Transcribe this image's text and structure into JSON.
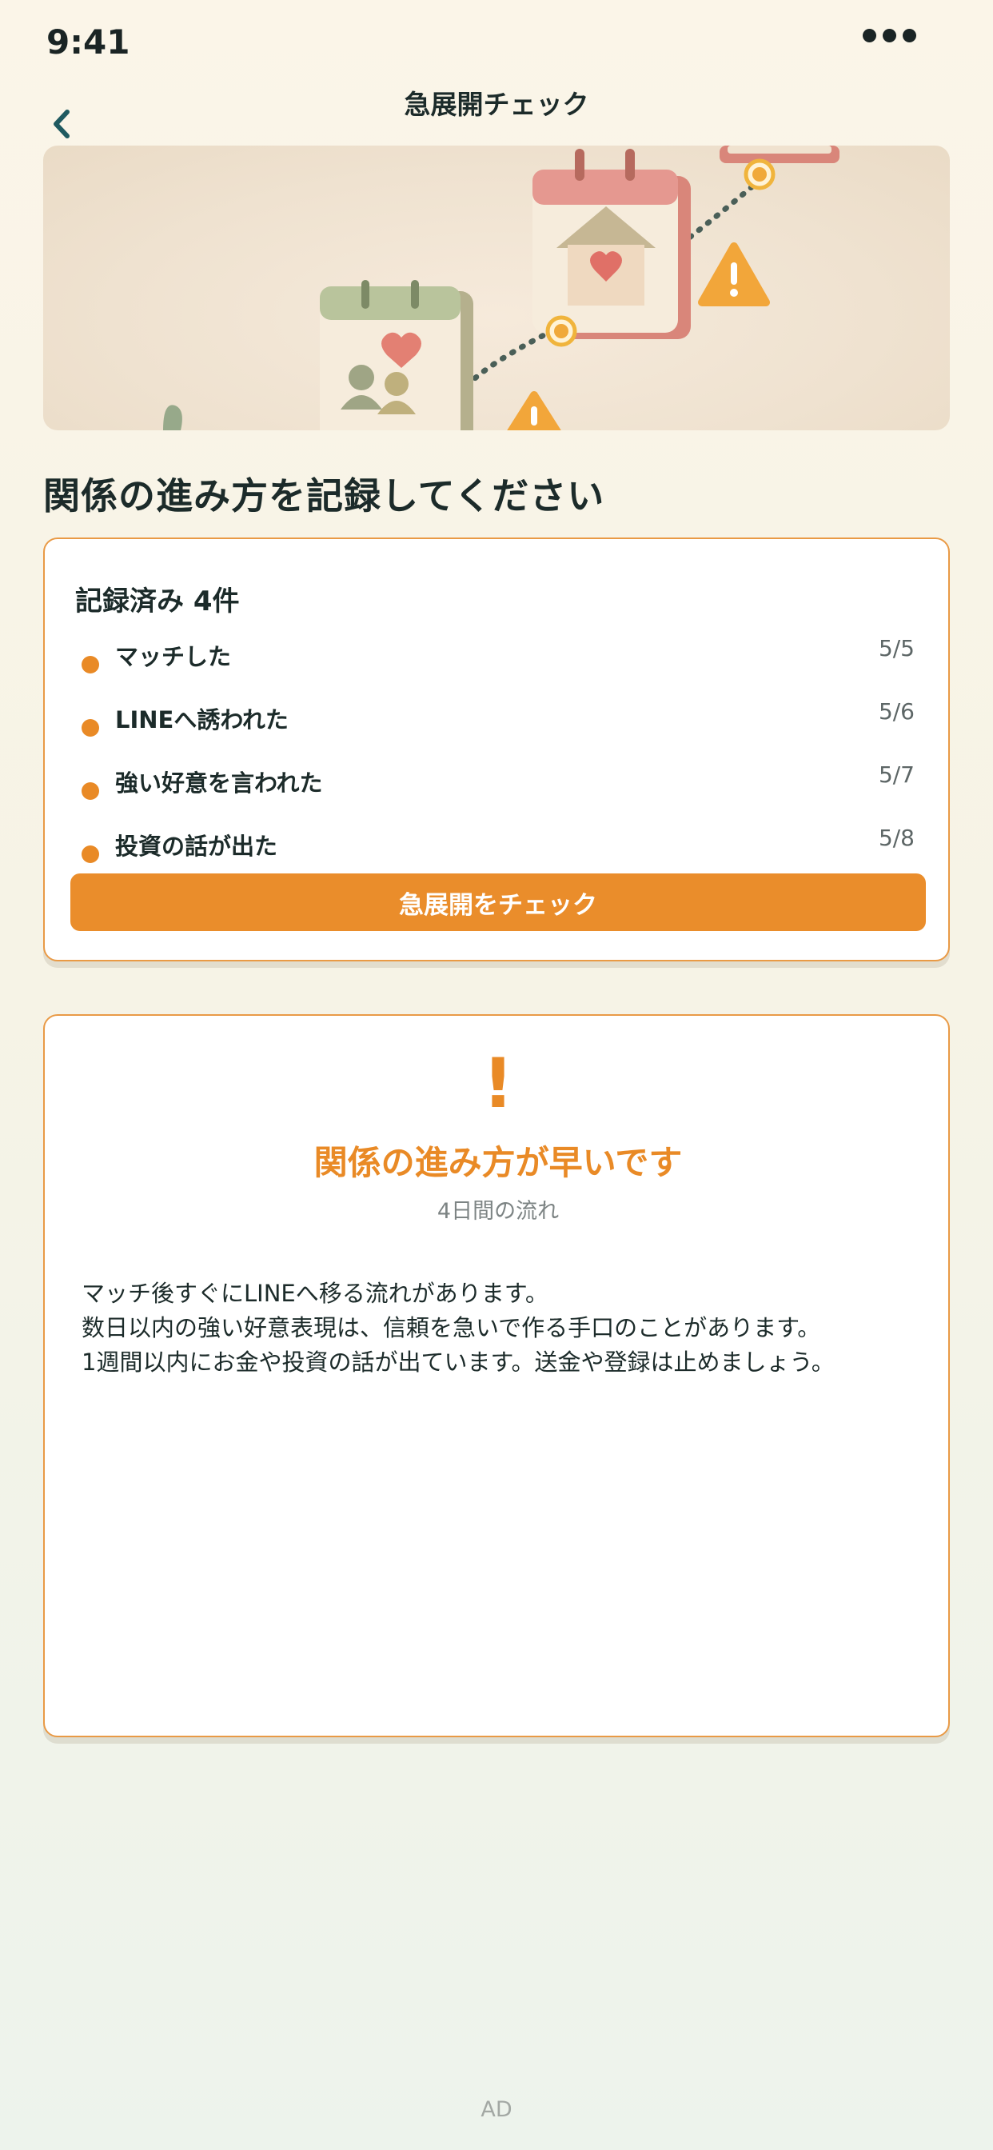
{
  "status_bar": {
    "time": "9:41"
  },
  "nav": {
    "title": "急展開チェック"
  },
  "heading": "関係の進み方を記録してください",
  "records": {
    "title": "記録済み 4件",
    "items": [
      {
        "label": "マッチした",
        "date": "5/5"
      },
      {
        "label": "LINEへ誘われた",
        "date": "5/6"
      },
      {
        "label": "強い好意を言われた",
        "date": "5/7"
      },
      {
        "label": "投資の話が出た",
        "date": "5/8"
      }
    ],
    "button_label": "急展開をチェック"
  },
  "result": {
    "icon": "!",
    "title": "関係の進み方が早いです",
    "subtitle": "4日間の流れ",
    "lines": [
      "マッチ後すぐにLINEへ移る流れがあります。",
      "数日以内の強い好意表現は、信頼を急いで作る手口のことがあります。",
      "1週間以内にお金や投資の話が出ています。送金や登録は止めましょう。"
    ]
  },
  "ad": {
    "label": "AD"
  },
  "colors": {
    "accent": "#ea8d2b",
    "text": "#1c2b2a",
    "muted": "#7d8484"
  }
}
